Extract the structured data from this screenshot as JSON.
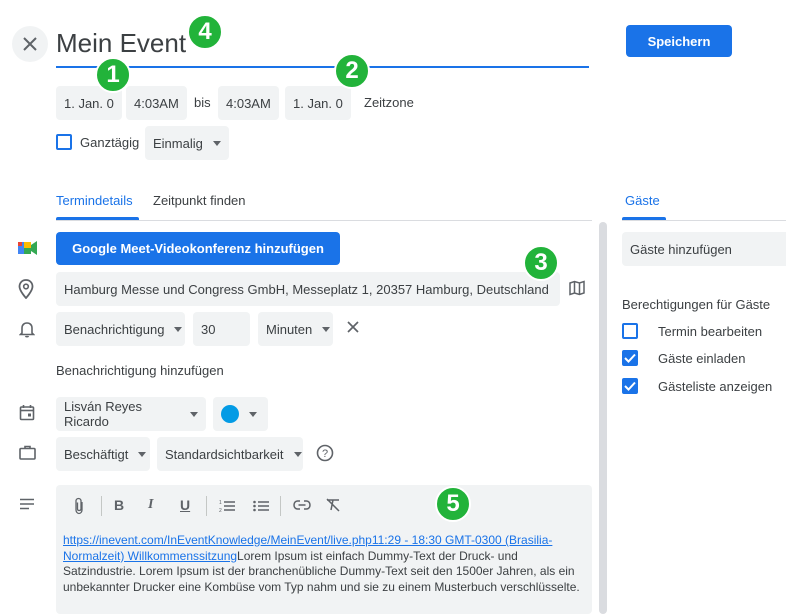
{
  "header": {
    "title": "Mein Event",
    "save_label": "Speichern"
  },
  "datetime": {
    "start_date": "1. Jan. 0",
    "start_time": "4:03AM",
    "to_label": "bis",
    "end_time": "4:03AM",
    "end_date": "1. Jan. 0",
    "timezone_label": "Zeitzone"
  },
  "options": {
    "all_day_label": "Ganztägig",
    "recurrence_value": "Einmalig"
  },
  "tabs": [
    {
      "label": "Termindetails",
      "active": true
    },
    {
      "label": "Zeitpunkt finden",
      "active": false
    }
  ],
  "details": {
    "meet_button_label": "Google Meet-Videokonferenz hinzufügen",
    "location": "Hamburg Messe und Congress GmbH, Messeplatz 1, 20357 Hamburg, Deutschland",
    "notification_type": "Benachrichtigung",
    "notification_value": "30",
    "notification_unit": "Minuten",
    "add_notification_label": "Benachrichtigung hinzufügen",
    "calendar_owner": "Lisván Reyes Ricardo",
    "event_color": "#039be5",
    "availability": "Beschäftigt",
    "visibility": "Standardsichtbarkeit",
    "description_link": "https://inevent.com/InEventKnowledge/MeinEvent/live.php11:29 - 18:30 GMT-0300 (Brasilia-Normalzeit) Willkommenssitzung",
    "description_text": "Lorem Ipsum ist einfach Dummy-Text der Druck- und Satzindustrie. Lorem Ipsum ist der branchenübliche Dummy-Text seit den 1500er Jahren, als ein unbekannter Drucker eine Kombüse vom Typ nahm und sie zu einem Musterbuch verschlüsselte."
  },
  "guests": {
    "tab_label": "Gäste",
    "add_placeholder": "Gäste hinzufügen",
    "permissions_title": "Berechtigungen für Gäste",
    "permissions": [
      {
        "label": "Termin bearbeiten",
        "checked": false
      },
      {
        "label": "Gäste einladen",
        "checked": true
      },
      {
        "label": "Gästeliste anzeigen",
        "checked": true
      }
    ]
  },
  "badges": [
    "1",
    "2",
    "3",
    "4",
    "5"
  ],
  "colors": {
    "accent": "#1a73e8",
    "badge": "#22b33a"
  }
}
